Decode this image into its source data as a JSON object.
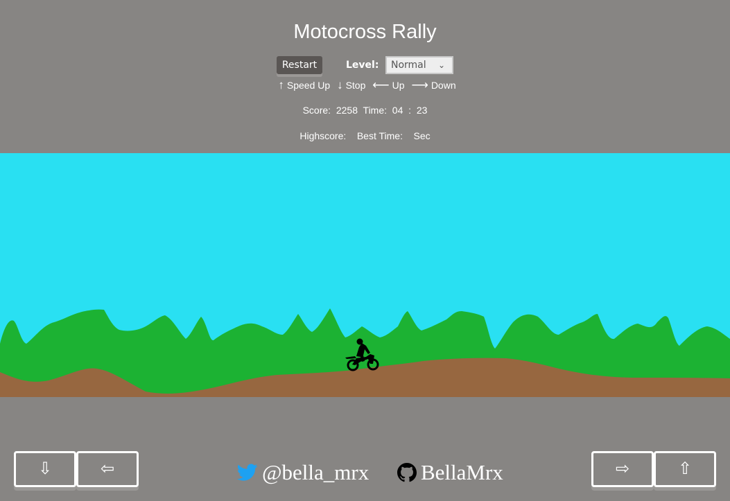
{
  "header": {
    "title": "Motocross Rally"
  },
  "toolbar": {
    "restart_label": "Restart",
    "level_label": "Level:",
    "level_selected": "Normal"
  },
  "help": {
    "up_arrow": "↑",
    "speed_up": "Speed Up",
    "down_arrow": "↓",
    "stop": "Stop",
    "left_arrow": "⟵",
    "up": "Up",
    "right_arrow": "⟶",
    "down": "Down"
  },
  "stats": {
    "score_label": "Score:",
    "score": "2258",
    "time_label": "Time:",
    "minutes": "04",
    "sep": ":",
    "seconds": "23",
    "highscore_label": "Highscore:",
    "best_time_label": "Best Time:",
    "sec_label": "Sec"
  },
  "keys": {
    "down": "⇩",
    "left": "⇦",
    "right": "⇨",
    "up": "⇧"
  },
  "social": {
    "twitter": "@bella_mrx",
    "github": "BellaMrx"
  },
  "colors": {
    "sky": "#29e0f2",
    "hills": "#1cb233",
    "dirt": "#976740",
    "background": "#878583",
    "twitter": "#1da1f2"
  },
  "icons": {
    "twitter": "twitter-bird-icon",
    "github": "github-icon",
    "rider": "motocross-rider-icon"
  }
}
